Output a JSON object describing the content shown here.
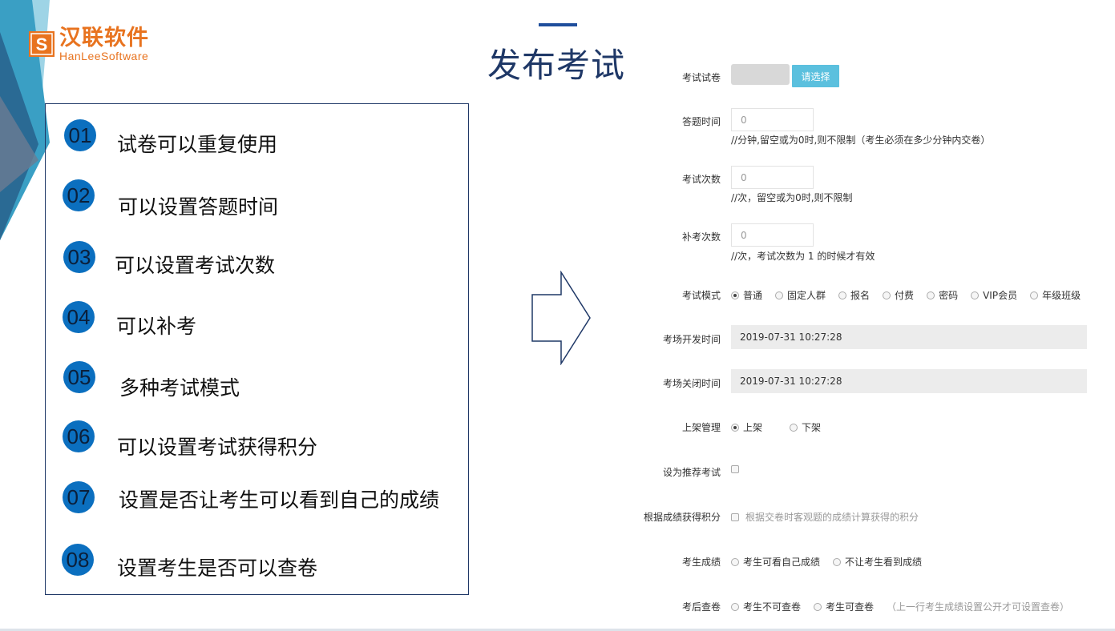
{
  "logo": {
    "cn": "汉联软件",
    "en": "HanLeeSoftware",
    "mark": "S"
  },
  "slide_title": "发布考试",
  "features": [
    {
      "num": "01",
      "text": "试卷可以重复使用"
    },
    {
      "num": "02",
      "text": "可以设置答题时间"
    },
    {
      "num": "03",
      "text": "可以设置考试次数"
    },
    {
      "num": "04",
      "text": "可以补考"
    },
    {
      "num": "05",
      "text": "多种考试模式"
    },
    {
      "num": "06",
      "text": "可以设置考试获得积分"
    },
    {
      "num": "07",
      "text": "设置是否让考生可以看到自己的成绩"
    },
    {
      "num": "08",
      "text": "设置考生是否可以查卷"
    }
  ],
  "form": {
    "paper": {
      "label": "考试试卷",
      "button": "请选择"
    },
    "answer_time": {
      "label": "答题时间",
      "value": "0",
      "hint": "//分钟,留空或为0时,则不限制（考生必须在多少分钟内交卷）"
    },
    "exam_times": {
      "label": "考试次数",
      "value": "0",
      "hint": "//次，留空或为0时,则不限制"
    },
    "makeup_times": {
      "label": "补考次数",
      "value": "0",
      "hint": "//次，考试次数为 1 的时候才有效"
    },
    "mode": {
      "label": "考试模式",
      "options": [
        "普通",
        "固定人群",
        "报名",
        "付费",
        "密码",
        "VIP会员",
        "年级班级"
      ],
      "selected": "普通"
    },
    "open_time": {
      "label": "考场开发时间",
      "value": "2019-07-31 10:27:28"
    },
    "close_time": {
      "label": "考场关闭时间",
      "value": "2019-07-31 10:27:28"
    },
    "shelf": {
      "label": "上架管理",
      "options": [
        "上架",
        "下架"
      ],
      "selected": "上架"
    },
    "recommend": {
      "label": "设为推荐考试"
    },
    "points": {
      "label": "根据成绩获得积分",
      "text": "根据交卷时客观题的成绩计算获得的积分"
    },
    "score_view": {
      "label": "考生成绩",
      "options": [
        "考生可看自己成绩",
        "不让考生看到成绩"
      ]
    },
    "review": {
      "label": "考后查卷",
      "options": [
        "考生不可查卷",
        "考生可查卷"
      ],
      "note": "（上一行考生成绩设置公开才可设置查卷）"
    }
  },
  "colors": {
    "brand_orange": "#e8731f",
    "title_navy": "#1f3867",
    "badge_blue": "#0b6fbf",
    "button_cyan": "#5bc0de"
  }
}
